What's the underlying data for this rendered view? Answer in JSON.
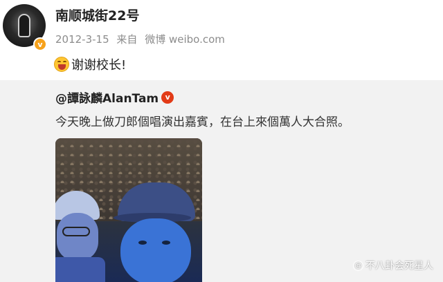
{
  "post": {
    "author": "南顺城街22号",
    "date": "2012-3-15",
    "source_prefix": "来自",
    "source": "微博 weibo.com",
    "text": "谢谢校长!",
    "emoji": "laughing-face-icon",
    "verified_badge": "v"
  },
  "repost": {
    "author": "@譚詠麟AlanTam",
    "verified_badge": "v",
    "text": "今天晚上做刀郎個唱演出嘉賓，在台上來個萬人大合照。"
  },
  "watermark": {
    "icon": "@",
    "text": "不八卦会死星人"
  },
  "colors": {
    "gold_badge": "#f7a21b",
    "red_badge": "#e23b17",
    "repost_bg": "#f2f2f2",
    "meta_text": "#8c8c8c"
  }
}
